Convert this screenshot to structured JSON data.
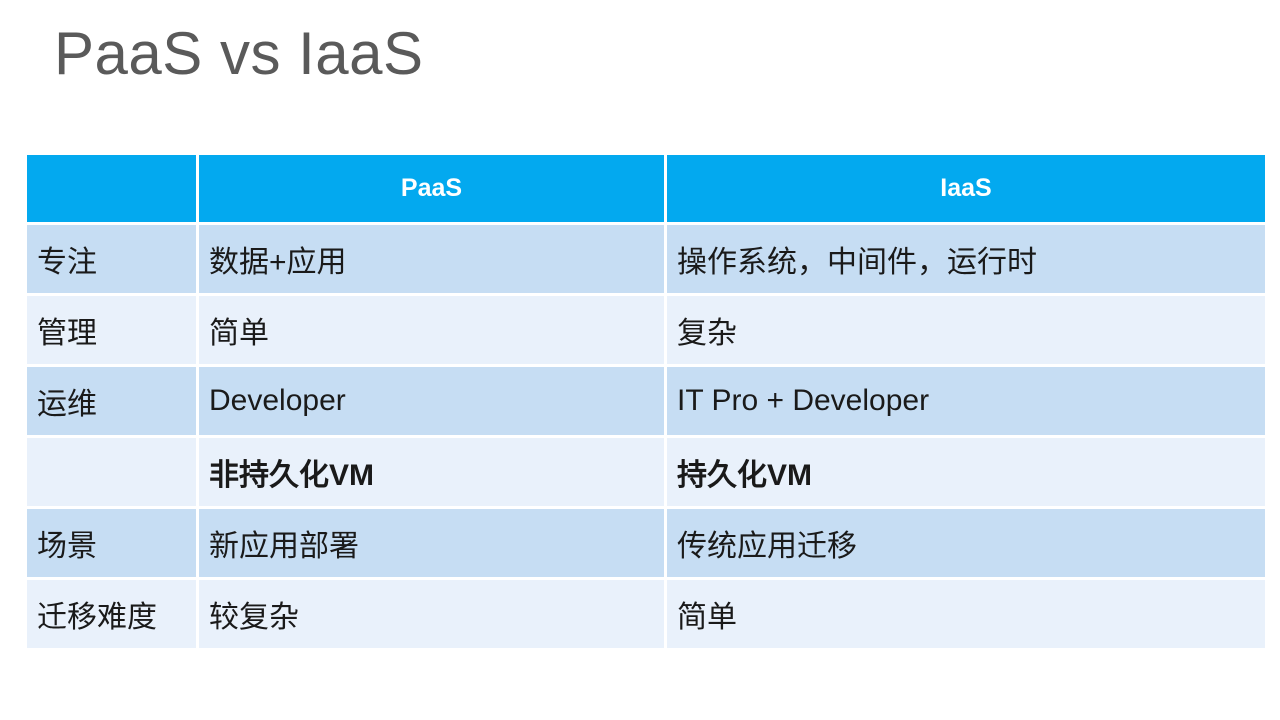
{
  "slide": {
    "title": "PaaS vs IaaS",
    "title_color": "#5a5a5a",
    "background": "#ffffff"
  },
  "table": {
    "header_bg": "#03a9ef",
    "header_text_color": "#ffffff",
    "row_dark_bg": "#c6ddf3",
    "row_light_bg": "#e9f1fb",
    "highlight_color": "#ff0000",
    "headers": [
      "",
      "PaaS",
      "IaaS"
    ],
    "rows": [
      {
        "label": "专注",
        "paas": "数据+应用",
        "iaas": "操作系统，中间件，运行时",
        "highlight": false
      },
      {
        "label": "管理",
        "paas": "简单",
        "iaas": "复杂",
        "highlight": false
      },
      {
        "label": "运维",
        "paas": "Developer",
        "iaas": "IT Pro + Developer",
        "highlight": false
      },
      {
        "label": "",
        "paas": "非持久化VM",
        "iaas": "持久化VM",
        "highlight": true
      },
      {
        "label": "场景",
        "paas": "新应用部署",
        "iaas": "传统应用迁移",
        "highlight": false
      },
      {
        "label": "迁移难度",
        "paas": "较复杂",
        "iaas": "简单",
        "highlight": false
      }
    ]
  }
}
